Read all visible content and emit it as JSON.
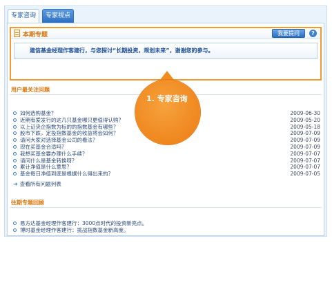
{
  "tabs": [
    {
      "label": "专家咨询",
      "active": true
    },
    {
      "label": "专家视点",
      "active": false
    }
  ],
  "topic": {
    "title": "本期专题",
    "ask_button": "我要提问",
    "help_glyph": "?",
    "banner_text": "建信基金经理作客建行，与您探讨“长期投资，规划未来”，谢谢您的参与。"
  },
  "hot_questions": {
    "heading": "用户最关注问题",
    "items": [
      {
        "text": "如何选购基金？",
        "date": "2009-06-30"
      },
      {
        "text": "近期有爱发行的这几只基金哪只更值得认购？",
        "date": "2009-05-20"
      },
      {
        "text": "以上证央企指数为标的的指数基金有哪些？",
        "date": "2009-05-18"
      },
      {
        "text": "股市下跌，定投指数基金的收益将会如何？",
        "date": "2009-07-09"
      },
      {
        "text": "请问大家对选择基金公司的看法？",
        "date": "2009-07-09"
      },
      {
        "text": "现在买基金合适吗？",
        "date": "2009-07-09"
      },
      {
        "text": "我想买基金要办理什么手续？",
        "date": "2009-07-07"
      },
      {
        "text": "请问什么是基金转换呀？",
        "date": "2009-07-07"
      },
      {
        "text": "累计净值是什么意思？",
        "date": "2009-07-07"
      },
      {
        "text": "基金每日净值到底是根据什么得出来的？",
        "date": "2009-07-05"
      }
    ],
    "view_all": "查看所有问题列表"
  },
  "past_topics": {
    "heading": "往期专题回顾",
    "items": [
      {
        "text": "易方达基金经理作客建行：3000点时代的投资新亮点。"
      },
      {
        "text": "博时基金经理作客建行：挑战指数基金新高度。"
      }
    ]
  },
  "callout": {
    "text": "1. 专家咨询"
  },
  "colors": {
    "accent_orange": "#f29a2e",
    "link_blue": "#2a4a7a",
    "tab_blue": "#2c6fc0"
  }
}
